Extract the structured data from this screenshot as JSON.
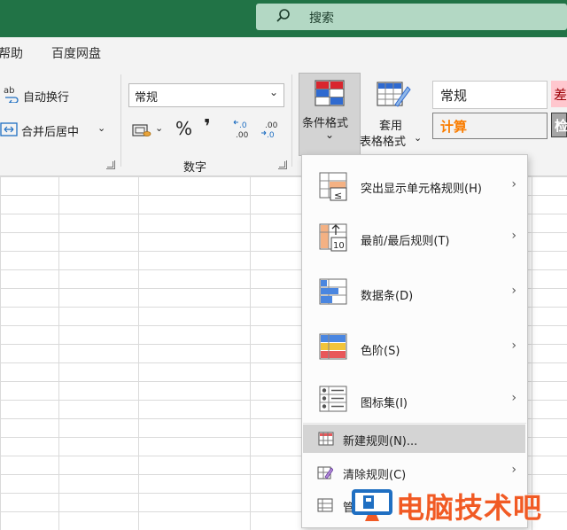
{
  "titlebar": {
    "search_placeholder": "搜索"
  },
  "menu": {
    "tabs": [
      "帮助",
      "百度网盘"
    ]
  },
  "ribbon": {
    "wrap_text": "自动换行",
    "merge_center": "合并后居中",
    "number_format": "常规",
    "percent_symbol": "%",
    "comma_symbol": "❜",
    "number_group_label": "数字",
    "cond_format_label": "条件格式",
    "cond_format_chevron": "⌄",
    "table_format_line1": "套用",
    "table_format_line2": "表格格式",
    "style_normal": "常规",
    "style_calc": "计算",
    "style_bad": "差",
    "style_check": "检"
  },
  "cf_menu": {
    "items": [
      {
        "label": "突出显示单元格规则(H)",
        "has_submenu": true,
        "icon": "highlight-cells-rules-icon"
      },
      {
        "label": "最前/最后规则(T)",
        "has_submenu": true,
        "icon": "top-bottom-rules-icon"
      },
      {
        "label": "数据条(D)",
        "has_submenu": true,
        "icon": "data-bars-icon"
      },
      {
        "label": "色阶(S)",
        "has_submenu": true,
        "icon": "color-scales-icon"
      },
      {
        "label": "图标集(I)",
        "has_submenu": true,
        "icon": "icon-sets-icon"
      }
    ],
    "new_rule": "新建规则(N)...",
    "clear_rules": "清除规则(C)",
    "manage_rules": "管"
  },
  "submenu_arrow": "›",
  "watermark": {
    "text": "电脑技术吧"
  },
  "colors": {
    "excel_green": "#217346",
    "accent_orange": "#f15a24"
  }
}
